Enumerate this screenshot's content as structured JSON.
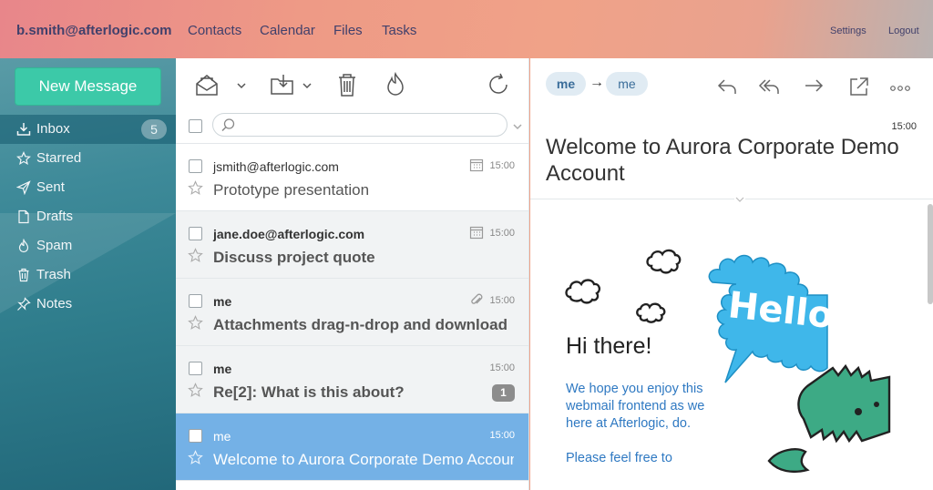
{
  "topbar": {
    "account": "b.smith@afterlogic.com",
    "nav": [
      "Contacts",
      "Calendar",
      "Files",
      "Tasks"
    ],
    "settings": "Settings",
    "logout": "Logout"
  },
  "sidebar": {
    "new_message": "New Message",
    "folders": [
      {
        "label": "Inbox",
        "icon": "inbox-icon",
        "count": "5"
      },
      {
        "label": "Starred",
        "icon": "star-icon"
      },
      {
        "label": "Sent",
        "icon": "send-icon"
      },
      {
        "label": "Drafts",
        "icon": "draft-icon"
      },
      {
        "label": "Spam",
        "icon": "spam-icon"
      },
      {
        "label": "Trash",
        "icon": "trash-icon"
      },
      {
        "label": "Notes",
        "icon": "pin-icon"
      }
    ]
  },
  "messages": [
    {
      "from": "jsmith@afterlogic.com",
      "subject": "Prototype presentation",
      "time": "15:00",
      "icon": "calendar-icon",
      "unread": false
    },
    {
      "from": "jane.doe@afterlogic.com",
      "subject": "Discuss project quote",
      "time": "15:00",
      "icon": "calendar-icon",
      "unread": true
    },
    {
      "from": "me",
      "subject": "Attachments drag-n-drop and download",
      "time": "15:00",
      "icon": "paperclip-icon",
      "unread": true
    },
    {
      "from": "me",
      "subject": "Re[2]: What is this about?",
      "time": "15:00",
      "thread_count": "1",
      "unread": true
    },
    {
      "from": "me",
      "subject": "Welcome to Aurora Corporate Demo Account",
      "time": "15:00",
      "selected": true
    }
  ],
  "pane": {
    "from_chip": "me",
    "to_chip": "me",
    "arrow": "→",
    "time": "15:00",
    "title": "Welcome to Aurora Corporate Demo Account",
    "greeting": "Hi there!",
    "body": "We hope you enjoy this webmail frontend as we here at Afterlogic, do.",
    "body2": "Please feel free to",
    "banner_text": "Hello, World"
  },
  "colors": {
    "accent_green": "#3cc9a8",
    "selected_row": "#74b1e6",
    "link_blue": "#2f79c2",
    "bubble_blue": "#3fb7ea",
    "croc_green": "#3daa85"
  }
}
